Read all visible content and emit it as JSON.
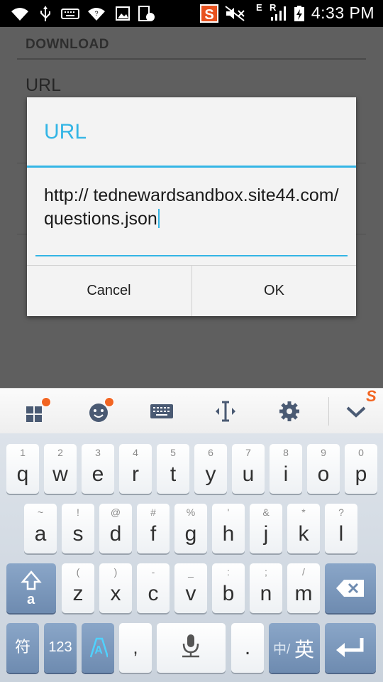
{
  "status_bar": {
    "time": "4:33 PM",
    "network_label": "E",
    "roaming_label": "R",
    "icons": [
      "wifi-icon",
      "usb-icon",
      "keyboard-icon",
      "wifi-hotspot-icon",
      "image-icon",
      "screenshot-icon",
      "s-app-icon",
      "mute-icon",
      "signal-icon",
      "battery-icon"
    ]
  },
  "background_screen": {
    "section_header": "DOWNLOAD",
    "pref_label": "URL"
  },
  "dialog": {
    "title": "URL",
    "url_value": "http:// tednewardsandbox.site44.com/ questions.json",
    "cancel_label": "Cancel",
    "ok_label": "OK",
    "accent_color": "#33b5e5"
  },
  "keyboard": {
    "toolbar_icons": [
      "apps-icon",
      "emoji-icon",
      "keyboard-icon",
      "cursor-move-icon",
      "settings-icon",
      "hide-keyboard-icon"
    ],
    "row1": [
      {
        "main": "q",
        "sub": "1"
      },
      {
        "main": "w",
        "sub": "2"
      },
      {
        "main": "e",
        "sub": "3"
      },
      {
        "main": "r",
        "sub": "4"
      },
      {
        "main": "t",
        "sub": "5"
      },
      {
        "main": "y",
        "sub": "6"
      },
      {
        "main": "u",
        "sub": "7"
      },
      {
        "main": "i",
        "sub": "8"
      },
      {
        "main": "o",
        "sub": "9"
      },
      {
        "main": "p",
        "sub": "0"
      }
    ],
    "row2": [
      {
        "main": "a",
        "sub": "~"
      },
      {
        "main": "s",
        "sub": "!"
      },
      {
        "main": "d",
        "sub": "@"
      },
      {
        "main": "f",
        "sub": "#"
      },
      {
        "main": "g",
        "sub": "%"
      },
      {
        "main": "h",
        "sub": "'"
      },
      {
        "main": "j",
        "sub": "&"
      },
      {
        "main": "k",
        "sub": "*"
      },
      {
        "main": "l",
        "sub": "?"
      }
    ],
    "row3": [
      {
        "main": "z",
        "sub": "("
      },
      {
        "main": "x",
        "sub": ")"
      },
      {
        "main": "c",
        "sub": "-"
      },
      {
        "main": "v",
        "sub": "_"
      },
      {
        "main": "b",
        "sub": ":"
      },
      {
        "main": "n",
        "sub": ";"
      },
      {
        "main": "m",
        "sub": "/"
      }
    ],
    "shift_sub": "a",
    "symbol_label": "符",
    "numbers_label": "123",
    "comma_label": ",",
    "period_label": ".",
    "lang_label_small": "中/",
    "lang_label_big": "英"
  }
}
